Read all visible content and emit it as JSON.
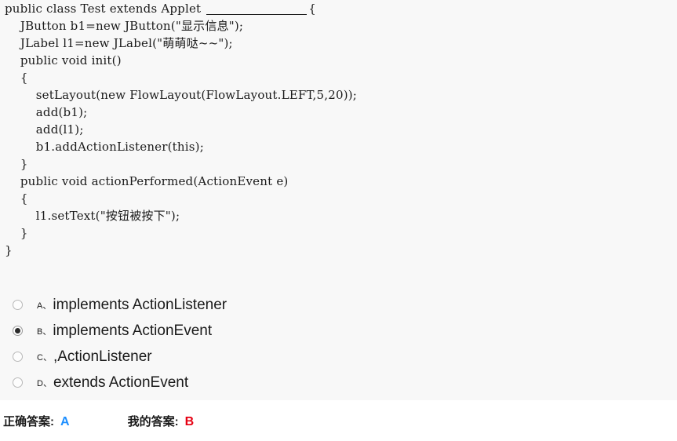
{
  "question": {
    "code_lines": [
      {
        "indent": 0,
        "pre": "public class Test extends Applet ",
        "blank": true,
        "post": "{"
      },
      {
        "indent": 1,
        "pre": "JButton b1=new JButton(\"显示信息\");",
        "blank": false,
        "post": ""
      },
      {
        "indent": 1,
        "pre": "JLabel l1=new JLabel(\"萌萌哒~~\");",
        "blank": false,
        "post": ""
      },
      {
        "indent": 1,
        "pre": "public void init()",
        "blank": false,
        "post": ""
      },
      {
        "indent": 1,
        "pre": "{",
        "blank": false,
        "post": ""
      },
      {
        "indent": 2,
        "pre": "setLayout(new FlowLayout(FlowLayout.LEFT,5,20));",
        "blank": false,
        "post": ""
      },
      {
        "indent": 2,
        "pre": "add(b1);",
        "blank": false,
        "post": ""
      },
      {
        "indent": 2,
        "pre": "add(l1);",
        "blank": false,
        "post": ""
      },
      {
        "indent": 2,
        "pre": "b1.addActionListener(this);",
        "blank": false,
        "post": ""
      },
      {
        "indent": 1,
        "pre": "}",
        "blank": false,
        "post": ""
      },
      {
        "indent": 1,
        "pre": "public void actionPerformed(ActionEvent e)",
        "blank": false,
        "post": ""
      },
      {
        "indent": 1,
        "pre": "{",
        "blank": false,
        "post": ""
      },
      {
        "indent": 2,
        "pre": "l1.setText(\"按钮被按下\");",
        "blank": false,
        "post": ""
      },
      {
        "indent": 1,
        "pre": "}",
        "blank": false,
        "post": ""
      },
      {
        "indent": 0,
        "pre": "}",
        "blank": false,
        "post": ""
      }
    ]
  },
  "options": [
    {
      "letter": "A、",
      "text": "implements ActionListener",
      "selected": false
    },
    {
      "letter": "B、",
      "text": "implements ActionEvent",
      "selected": true
    },
    {
      "letter": "C、",
      "text": ",ActionListener",
      "selected": false
    },
    {
      "letter": "D、",
      "text": "extends ActionEvent",
      "selected": false
    }
  ],
  "answer_bar": {
    "correct_label": "正确答案:",
    "correct_value": "A",
    "correct_color": "#1e8fff",
    "my_label": "我的答案:",
    "my_value": "B",
    "my_color": "#e60012"
  }
}
